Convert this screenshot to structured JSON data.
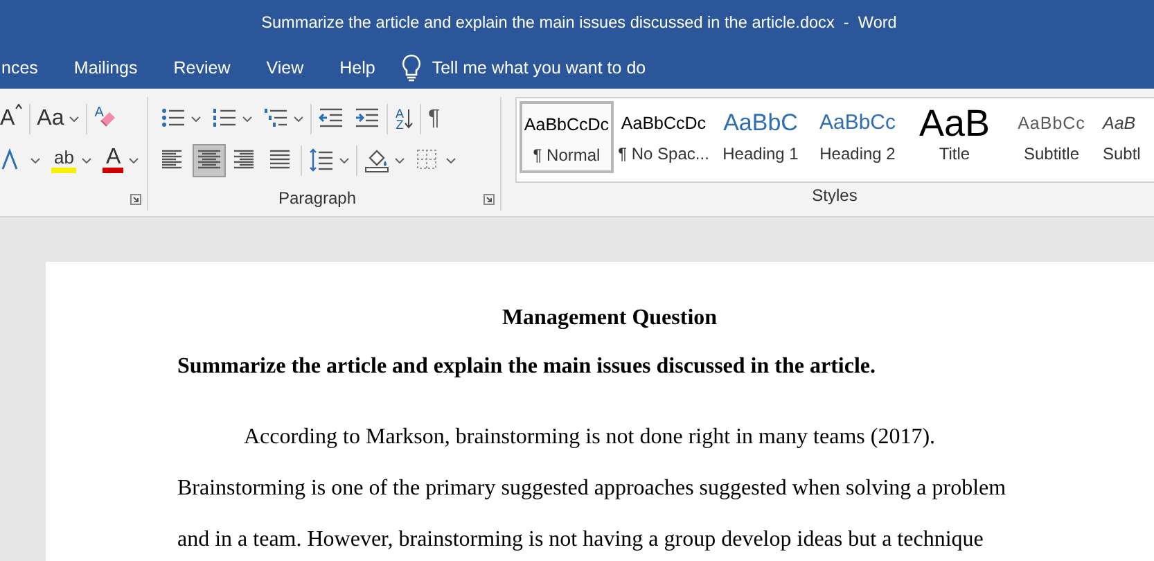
{
  "title_bar": {
    "title": "Summarize the article and explain the main issues discussed in the article.docx  -  Word"
  },
  "menu_tabs": [
    {
      "label": "nces"
    },
    {
      "label": "Mailings"
    },
    {
      "label": "Review"
    },
    {
      "label": "View"
    },
    {
      "label": "Help"
    }
  ],
  "tell_me": {
    "placeholder": "Tell me what you want to do"
  },
  "font_group": {
    "row1": [
      {
        "kind": "grow",
        "glyph": "A"
      },
      {
        "kind": "case",
        "glyph": "Aa"
      },
      {
        "kind": "clear",
        "glyph": "A"
      }
    ],
    "row2": [
      {
        "kind": "effects"
      },
      {
        "kind": "highlight",
        "glyph": "ab"
      },
      {
        "kind": "color",
        "glyph": "A"
      }
    ]
  },
  "paragraph_group": {
    "label": "Paragraph",
    "row1": [
      {
        "kind": "bullets"
      },
      {
        "kind": "numbering"
      },
      {
        "kind": "multilevel"
      },
      {
        "kind": "outdent"
      },
      {
        "kind": "indent"
      },
      {
        "kind": "sort",
        "glyph": "A Z"
      },
      {
        "kind": "marks",
        "glyph": "¶"
      }
    ],
    "row2": [
      {
        "kind": "align_left",
        "selected": false
      },
      {
        "kind": "align_center",
        "selected": true
      },
      {
        "kind": "align_right",
        "selected": false
      },
      {
        "kind": "justify",
        "selected": false
      },
      {
        "kind": "spacing"
      },
      {
        "kind": "shading"
      },
      {
        "kind": "borders"
      }
    ]
  },
  "styles_group": {
    "label": "Styles",
    "items": [
      {
        "kind": "normal",
        "preview": "AaBbCcDc",
        "name": "¶ Normal",
        "selected": true
      },
      {
        "kind": "plain",
        "preview": "AaBbCcDc",
        "name": "¶ No Spac...",
        "selected": false
      },
      {
        "kind": "heading1",
        "preview": "AaBbC",
        "name": "Heading 1",
        "selected": false
      },
      {
        "kind": "heading2",
        "preview": "AaBbCc",
        "name": "Heading 2",
        "selected": false
      },
      {
        "kind": "title",
        "preview": "AaB",
        "name": "Title",
        "selected": false
      },
      {
        "kind": "subtitle",
        "preview": "AaBbCc",
        "name": "Subtitle",
        "selected": false
      },
      {
        "kind": "subtle",
        "preview": "AaB",
        "name": "Subtl",
        "selected": false
      }
    ]
  },
  "document": {
    "heading": "Management Question",
    "question": "Summarize the article and explain the main issues discussed in the article.",
    "paragraph_lines": [
      "According to Markson, brainstorming is not done right in many teams (2017).",
      "Brainstorming is one of the primary suggested approaches suggested when solving a problem",
      "and in a team. However, brainstorming is not having a group develop ideas but a technique"
    ]
  }
}
